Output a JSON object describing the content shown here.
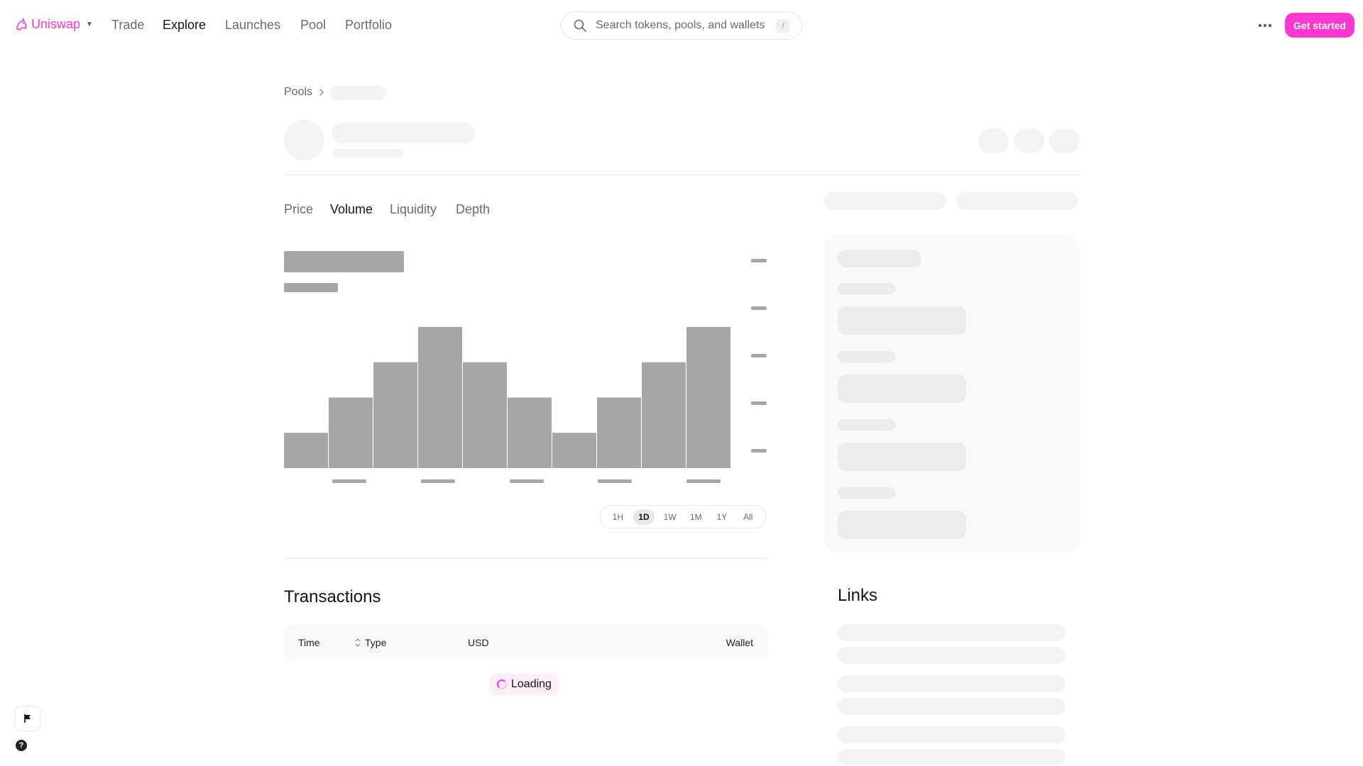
{
  "nav": {
    "brand": "Uniswap",
    "links": [
      "Trade",
      "Explore",
      "Launches",
      "Pool",
      "Portfolio"
    ],
    "active": "Explore",
    "search_placeholder": "Search tokens, pools, and wallets",
    "search_shortcut": "/",
    "cta": "Get started"
  },
  "breadcrumb": {
    "root": "Pools"
  },
  "chart_tabs": [
    "Price",
    "Volume",
    "Liquidity",
    "Depth"
  ],
  "active_tab": "Volume",
  "time_ranges": [
    "1H",
    "1D",
    "1W",
    "1M",
    "1Y",
    "All"
  ],
  "selected_range": "1D",
  "chart_data": {
    "type": "bar",
    "state": "loading-skeleton",
    "values": [
      1,
      2,
      3,
      4,
      3,
      2,
      1,
      2,
      3,
      4
    ]
  },
  "transactions": {
    "title": "Transactions",
    "columns": [
      "Time",
      "Type",
      "USD",
      "Wallet"
    ],
    "loading_label": "Loading"
  },
  "links": {
    "title": "Links"
  },
  "colors": {
    "brand": "#FC37D2",
    "skeleton": "#f3f3f3",
    "bar": "#a6a6a6"
  },
  "icons": {
    "brand": "unicorn-logo-icon",
    "search": "search-icon",
    "more": "more-horizontal-icon",
    "flag": "flag-icon",
    "help": "help-icon"
  }
}
